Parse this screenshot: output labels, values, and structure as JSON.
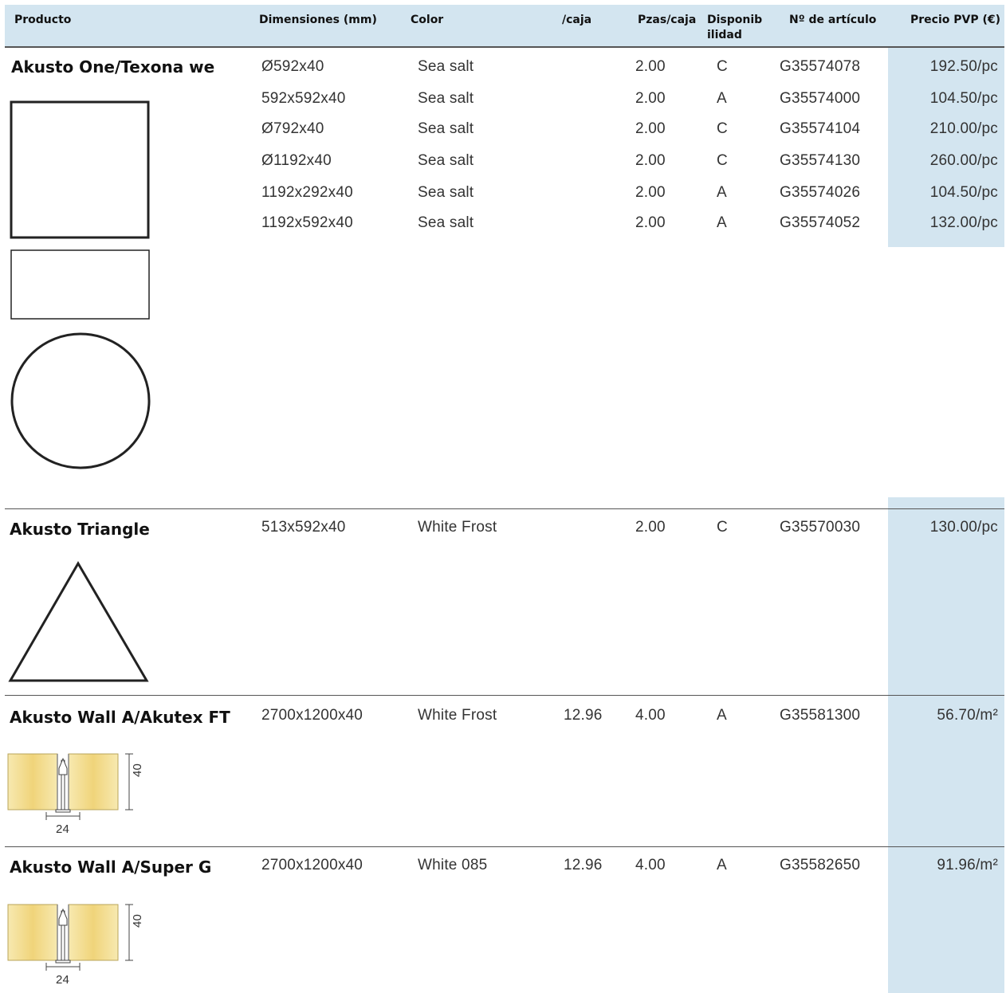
{
  "columns": {
    "producto": "Producto",
    "dimensiones": "Dimensiones (mm)",
    "color": "Color",
    "caja": "/caja",
    "pzas": "Pzas/caja",
    "disponibilidad_line1": "Disponib",
    "disponibilidad_line2": "ilidad",
    "articulo": "Nº de artículo",
    "precio": "Precio PVP (€)"
  },
  "products": [
    {
      "name": "Akusto One/Texona we",
      "rows": [
        {
          "dim": "Ø592x40",
          "color": "Sea salt",
          "caja": "",
          "pzas": "2.00",
          "disp": "C",
          "art": "G35574078",
          "price": "192.50/pc"
        },
        {
          "dim": "592x592x40",
          "color": "Sea salt",
          "caja": "",
          "pzas": "2.00",
          "disp": "A",
          "art": "G35574000",
          "price": "104.50/pc"
        },
        {
          "dim": "Ø792x40",
          "color": "Sea salt",
          "caja": "",
          "pzas": "2.00",
          "disp": "C",
          "art": "G35574104",
          "price": "210.00/pc"
        },
        {
          "dim": "Ø1192x40",
          "color": "Sea salt",
          "caja": "",
          "pzas": "2.00",
          "disp": "C",
          "art": "G35574130",
          "price": "260.00/pc"
        },
        {
          "dim": "1192x292x40",
          "color": "Sea salt",
          "caja": "",
          "pzas": "2.00",
          "disp": "A",
          "art": "G35574026",
          "price": "104.50/pc"
        },
        {
          "dim": "1192x592x40",
          "color": "Sea salt",
          "caja": "",
          "pzas": "2.00",
          "disp": "A",
          "art": "G35574052",
          "price": "132.00/pc"
        }
      ]
    },
    {
      "name": "Akusto Triangle",
      "rows": [
        {
          "dim": "513x592x40",
          "color": "White Frost",
          "caja": "",
          "pzas": "2.00",
          "disp": "C",
          "art": "G35570030",
          "price": "130.00/pc"
        }
      ]
    },
    {
      "name": "Akusto Wall A/Akutex FT",
      "rows": [
        {
          "dim": "2700x1200x40",
          "color": "White Frost",
          "caja": "12.96",
          "pzas": "4.00",
          "disp": "A",
          "art": "G35581300",
          "price": "56.70/m²"
        }
      ],
      "diagram": {
        "height_label": "40",
        "width_label": "24"
      }
    },
    {
      "name": "Akusto Wall A/Super G",
      "rows": [
        {
          "dim": "2700x1200x40",
          "color": "White 085",
          "caja": "12.96",
          "pzas": "4.00",
          "disp": "A",
          "art": "G35582650",
          "price": "91.96/m²"
        }
      ],
      "diagram": {
        "height_label": "40",
        "width_label": "24"
      }
    }
  ],
  "colors": {
    "header_bg": "#d3e5f0",
    "price_band": "#d3e5f0",
    "panel_yellow": "#f3dc8a"
  }
}
